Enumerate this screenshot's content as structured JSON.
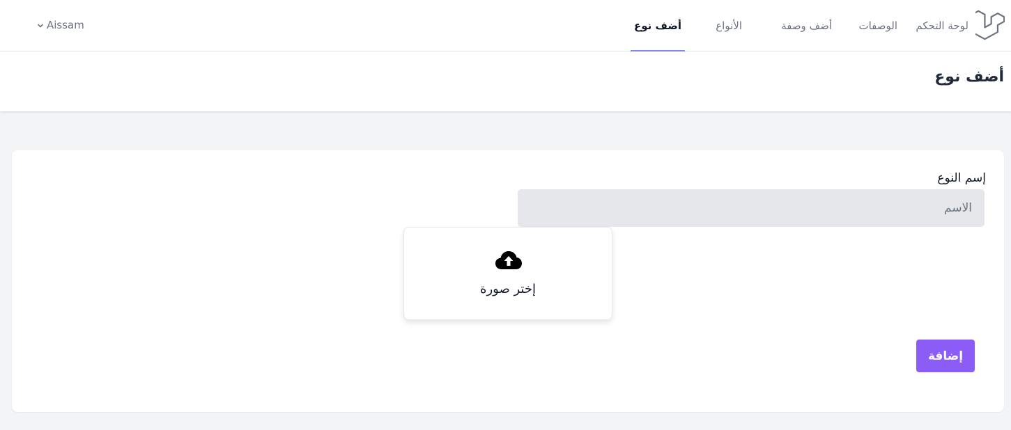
{
  "nav": {
    "logo": "laravel-logo-icon",
    "links": [
      {
        "label": "لوحة التحكم",
        "active": false
      },
      {
        "label": "الوصفات",
        "active": false
      },
      {
        "label": "أضف وصفة",
        "active": false
      },
      {
        "label": "الأنواع",
        "active": false
      },
      {
        "label": "أضف نوع",
        "active": true
      }
    ],
    "user_name": "Aissam",
    "user_icon": "chevron-down-icon"
  },
  "header": {
    "title": "أضف نوع"
  },
  "form": {
    "name_label": "إسم النوع",
    "name_placeholder": "الاسم",
    "name_value": "",
    "upload_icon": "cloud-upload-icon",
    "upload_label": "إختر صورة",
    "submit_label": "إضافة"
  },
  "colors": {
    "accent": "#8b5cf6",
    "active_underline": "#818cf8",
    "background": "#f3f4f6",
    "input_bg": "#e5e7eb"
  }
}
